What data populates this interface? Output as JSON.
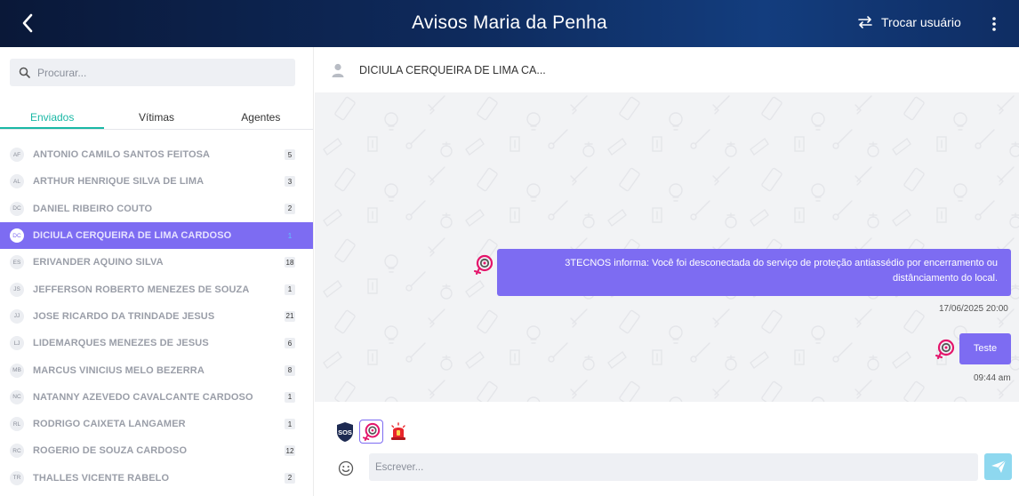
{
  "header": {
    "title": "Avisos Maria da Penha",
    "switch_user_label": "Trocar usuário"
  },
  "sidebar": {
    "search_placeholder": "Procurar...",
    "tabs": [
      {
        "label": "Enviados",
        "active": true
      },
      {
        "label": "Vítimas",
        "active": false
      },
      {
        "label": "Agentes",
        "active": false
      }
    ],
    "contacts": [
      {
        "initials": "AF",
        "name": "ANTONIO CAMILO SANTOS FEITOSA",
        "count": "5"
      },
      {
        "initials": "AL",
        "name": "ARTHUR HENRIQUE SILVA DE LIMA",
        "count": "3"
      },
      {
        "initials": "DC",
        "name": "DANIEL RIBEIRO COUTO",
        "count": "2"
      },
      {
        "initials": "DC",
        "name": "DICIULA CERQUEIRA DE LIMA CARDOSO",
        "count": "1"
      },
      {
        "initials": "ES",
        "name": "ERIVANDER AQUINO SILVA",
        "count": "18"
      },
      {
        "initials": "JS",
        "name": "JEFFERSON ROBERTO MENEZES DE SOUZA",
        "count": "1"
      },
      {
        "initials": "JJ",
        "name": "JOSE RICARDO DA TRINDADE JESUS",
        "count": "21"
      },
      {
        "initials": "LJ",
        "name": "LIDEMARQUES MENEZES DE JESUS",
        "count": "6"
      },
      {
        "initials": "MB",
        "name": "MARCUS VINICIUS MELO BEZERRA",
        "count": "8"
      },
      {
        "initials": "NC",
        "name": "NATANNY AZEVEDO CAVALCANTE CARDOSO",
        "count": "1"
      },
      {
        "initials": "RL",
        "name": "RODRIGO CAIXETA LANGAMER",
        "count": "1"
      },
      {
        "initials": "RC",
        "name": "ROGERIO DE SOUZA CARDOSO",
        "count": "12"
      },
      {
        "initials": "TR",
        "name": "THALLES VICENTE RABELO",
        "count": "2"
      }
    ],
    "selected_index": 3
  },
  "chat": {
    "contact_name": "DICIULA CERQUEIRA DE LIMA CA...",
    "messages": [
      {
        "text": "3TECNOS informa: Você foi desconectada do serviço de proteção antiassédio por encerramento ou distânciamento do local.",
        "time": "17/06/2025 20:00"
      },
      {
        "text": "Teste",
        "time": "09:44 am"
      }
    ]
  },
  "composer": {
    "placeholder": "Escrever...",
    "alert_buttons": [
      "sos-badge-icon",
      "maria-da-penha-icon",
      "siren-icon"
    ],
    "sos_label": "SOS"
  },
  "colors": {
    "accent": "#7d6cf2",
    "active_tab": "#19b8a5",
    "send_button": "#8ed8ef",
    "header_dark": "#0a1838",
    "header_light": "#133d7e"
  }
}
